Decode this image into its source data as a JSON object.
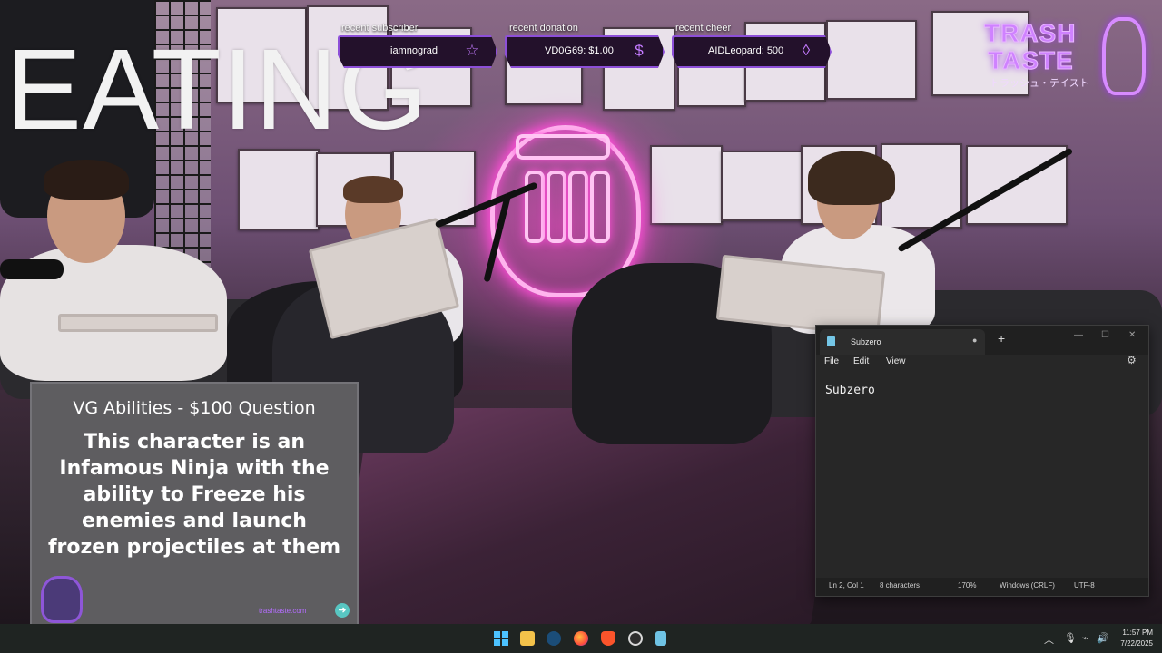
{
  "overlay": {
    "big_text": "EATING"
  },
  "alerts": {
    "subscriber": {
      "label": "recent subscriber",
      "value": "iamnograd",
      "icon": "star-icon"
    },
    "donation": {
      "label": "recent donation",
      "value": "VD0G69: $1.00",
      "icon": "dollar-icon"
    },
    "cheer": {
      "label": "recent cheer",
      "value": "AIDLeopard: 500",
      "icon": "bits-icon"
    }
  },
  "brand": {
    "line1": "TRASH",
    "line2": "TASTE",
    "sub": "トラッシュ・テイスト",
    "accent": "#cf82ff"
  },
  "question": {
    "title": "VG Abilities - $100 Question",
    "body": "This character is an Infamous Ninja with the ability to Freeze his enemies and launch frozen projectiles at them",
    "footer_link": "trashtaste.com",
    "panel_color": "#5e5d60"
  },
  "notepad": {
    "tab_title": "Subzero",
    "menu": [
      "File",
      "Edit",
      "View"
    ],
    "content": "Subzero",
    "status": {
      "position": "Ln 2, Col 1",
      "chars": "8 characters",
      "zoom": "170%",
      "line_endings": "Windows (CRLF)",
      "encoding": "UTF-8"
    }
  },
  "taskbar": {
    "time": "11:57 PM",
    "date": "7/22/2025",
    "pinned": [
      "windows-start-icon",
      "file-explorer-icon",
      "steam-icon",
      "firefox-icon",
      "brave-icon",
      "obs-icon",
      "notepad-icon"
    ]
  }
}
